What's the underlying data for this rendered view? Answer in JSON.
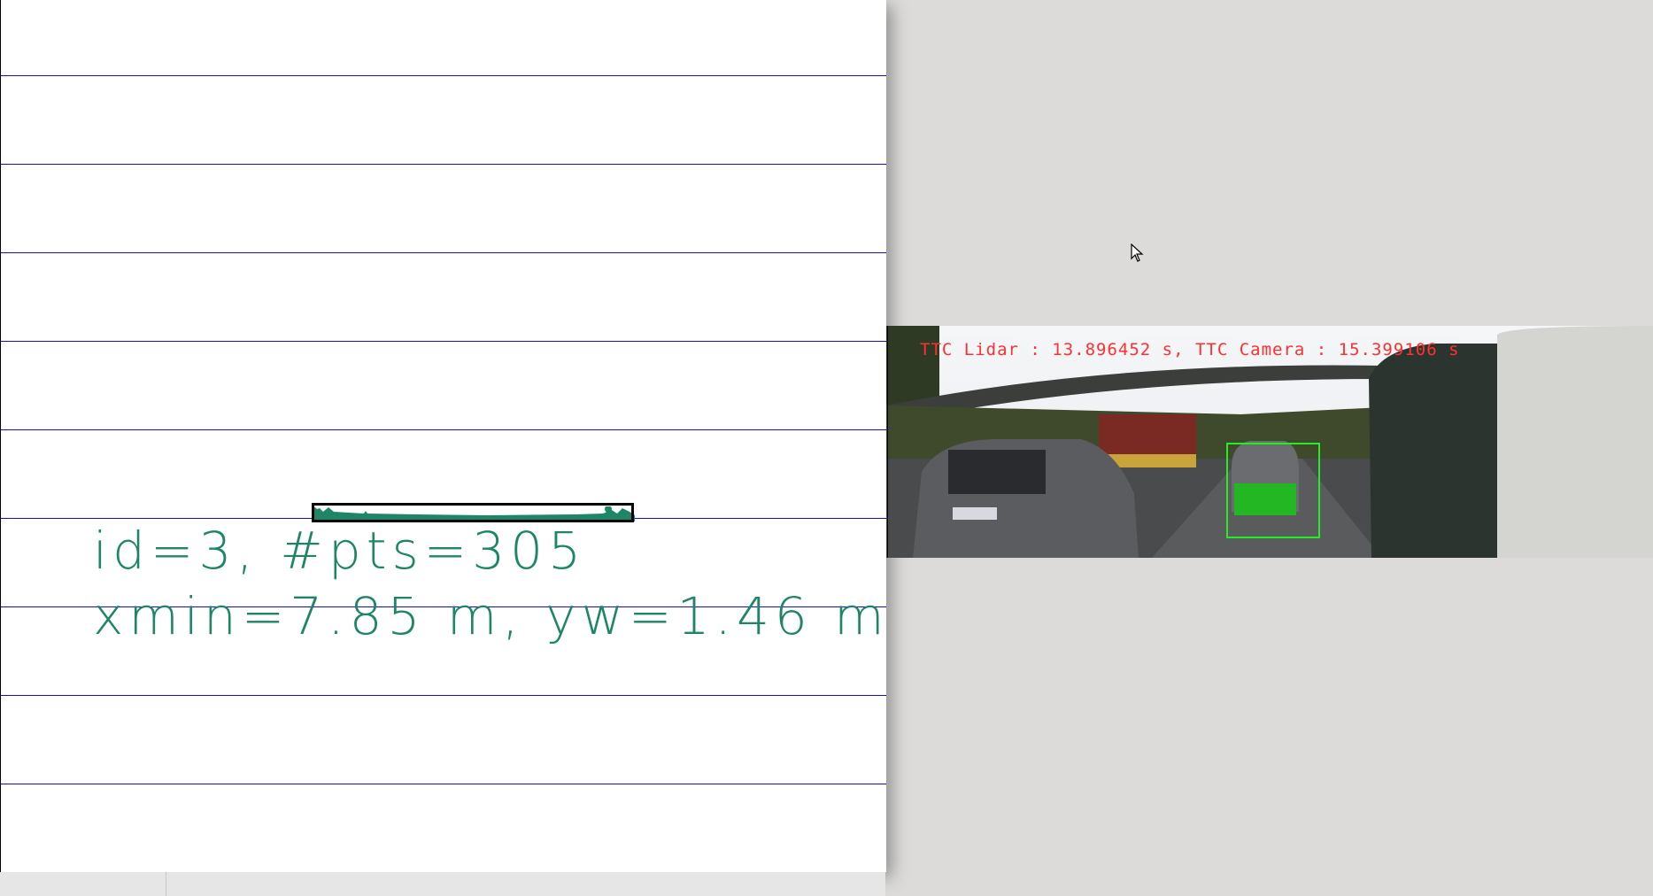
{
  "topview": {
    "object_label_line1": "id=3, #pts=305",
    "object_label_line2": "xmin=7.85 m, yw=1.46 m",
    "marker_color": "#1e8567",
    "grid_color": "#1010c8"
  },
  "camera_view": {
    "ttc_text": "TTC Lidar : 13.896452 s, TTC Camera : 15.399106 s",
    "ttc_color": "#ff3030",
    "roi_color": "#22ee22"
  }
}
